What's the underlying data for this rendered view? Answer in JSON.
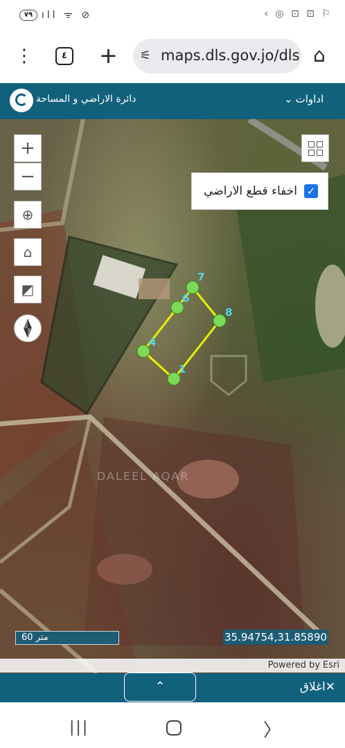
{
  "status_bar": {
    "battery": "٧٩",
    "left_icons": "ıll ᯤ ⊘",
    "right_icons": "‹ ◎ ⊡ ⊡ ⚐"
  },
  "browser": {
    "menu_icon": "⋮",
    "tab_count": "٤",
    "new_tab_icon": "+",
    "url": "maps.dls.gov.jo/dls",
    "tune_icon": "⚟",
    "home_icon": "⌂"
  },
  "header": {
    "tools_label": "اداوات",
    "tools_caret": "⌄",
    "title": "دائرة الاراضي و المساحة"
  },
  "map": {
    "zoom_in": "+",
    "zoom_out": "−",
    "locate_icon": "⊕",
    "home_icon": "⌂",
    "measure_icon": "◩",
    "hide_parcels_label": "اخفاء قطع الاراضي",
    "hide_parcels_checked": "✓",
    "scale_label": "60 متر",
    "coordinates": "35.94754,31.85890",
    "powered_by": "Powered by Esri",
    "watermark": "DALEEL AQAR",
    "vertex_labels": [
      "7",
      "6",
      "8",
      "4",
      "1"
    ]
  },
  "bottom_panel": {
    "expand_icon": "⌃",
    "close_label": "اغلاق",
    "close_icon": "✕"
  },
  "nav": {
    "recents_icon": "|||",
    "back_icon": "〉"
  }
}
